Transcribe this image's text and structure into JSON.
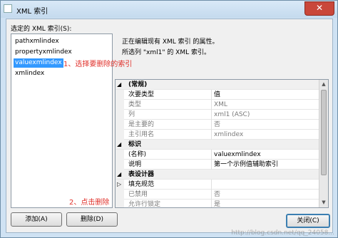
{
  "window": {
    "title": "XML 索引",
    "close_glyph": "✕"
  },
  "left_panel": {
    "label": "选定的 XML 索引(S):",
    "items": [
      {
        "label": "pathxmlindex"
      },
      {
        "label": "propertyxmlindex"
      },
      {
        "label": "valuexmlindex",
        "selected": true
      },
      {
        "label": "xmlindex"
      }
    ]
  },
  "description": {
    "line1": "正在编辑现有 XML 索引 的属性。",
    "line2": "所选列 \"xml1\" 的 XML 索引。"
  },
  "property_grid": {
    "rows": [
      {
        "type": "category",
        "toggle": "◢",
        "name": "(常规)",
        "value": ""
      },
      {
        "type": "property",
        "readonly": false,
        "name": "次要类型",
        "value": "值"
      },
      {
        "type": "property",
        "readonly": true,
        "name": "类型",
        "value": "XML"
      },
      {
        "type": "property",
        "readonly": true,
        "name": "列",
        "value": "xml1 (ASC)"
      },
      {
        "type": "property",
        "readonly": true,
        "name": "是主要的",
        "value": "否"
      },
      {
        "type": "property",
        "readonly": true,
        "name": "主引用名",
        "value": "xmlindex"
      },
      {
        "type": "category",
        "toggle": "◢",
        "name": "标识",
        "value": ""
      },
      {
        "type": "property",
        "readonly": false,
        "name": "(名称)",
        "value": "valuexmlindex"
      },
      {
        "type": "property",
        "readonly": false,
        "name": "说明",
        "value": "第一个示例值辅助索引"
      },
      {
        "type": "category",
        "toggle": "◢",
        "name": "表设计器",
        "value": ""
      },
      {
        "type": "property",
        "readonly": false,
        "toggle": "▷",
        "name": "填充规范",
        "value": ""
      },
      {
        "type": "property",
        "readonly": true,
        "name": "已禁用",
        "value": "否"
      },
      {
        "type": "property",
        "readonly": true,
        "name": "允许行锁定",
        "value": "是"
      }
    ]
  },
  "buttons": {
    "add": "添加(A)",
    "delete": "删除(D)",
    "close": "关闭(C)"
  },
  "annotations": {
    "step1": "1、选择要删除的索引",
    "step2": "2、点击删除"
  },
  "watermark": "http://blog.csdn.net/qq_24058..."
}
